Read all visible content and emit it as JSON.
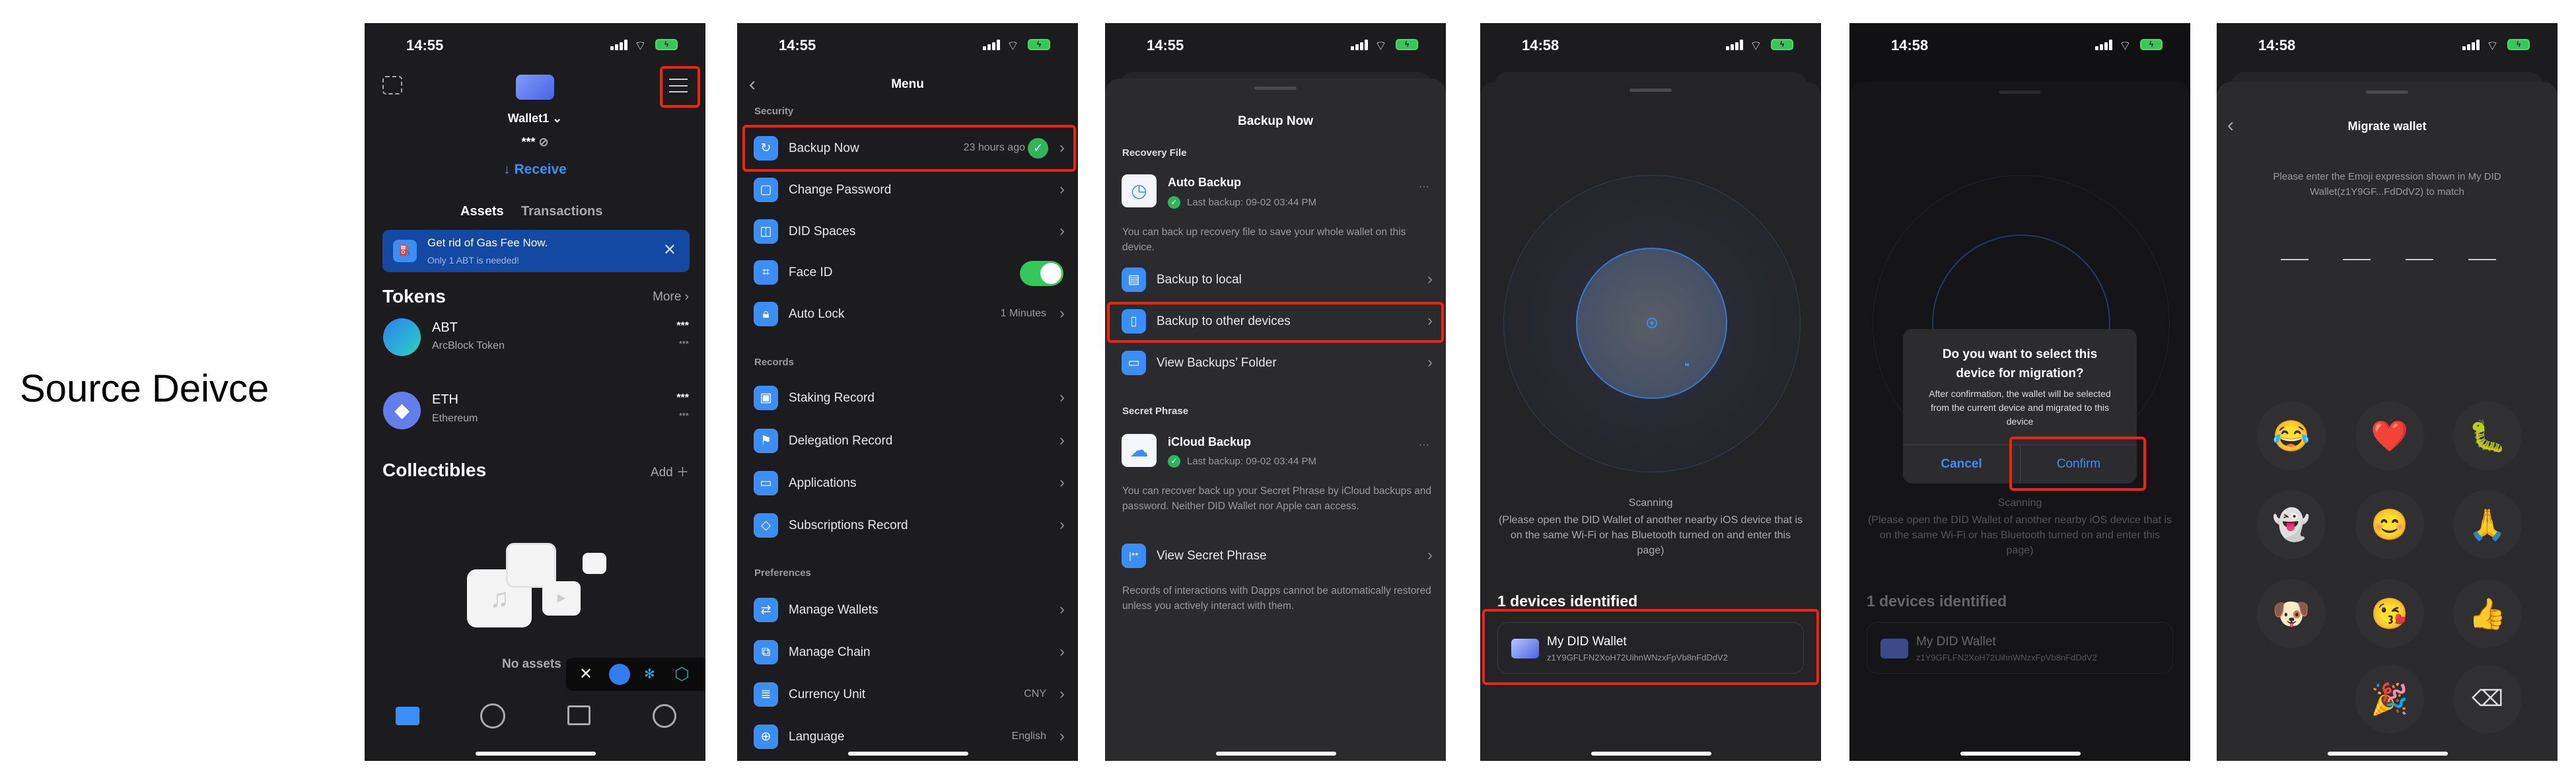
{
  "side_label": "Source Deivce",
  "accent_color": "#3a8ef6",
  "highlight_color": "#f0230f",
  "home": {
    "time": "14:55",
    "wallet_name": "Wallet1",
    "balance_masked": "***",
    "receive_label": "Receive",
    "tabs": [
      "Assets",
      "Transactions"
    ],
    "banner": {
      "title": "Get rid of Gas Fee Now.",
      "subtitle": "Only 1 ABT is needed!"
    },
    "tokens_heading": "Tokens",
    "more_label": "More",
    "tokens": [
      {
        "symbol": "ABT",
        "name": "ArcBlock Token",
        "amount": "***",
        "value": "***"
      },
      {
        "symbol": "ETH",
        "name": "Ethereum",
        "amount": "***",
        "value": "***"
      }
    ],
    "collectibles_heading": "Collectibles",
    "add_label": "Add",
    "empty_label": "No assets"
  },
  "menu": {
    "time": "14:55",
    "title": "Menu",
    "sections": [
      {
        "title": "Security",
        "items": [
          {
            "label": "Backup Now",
            "value": "23 hours ago",
            "icon": "refresh-icon"
          },
          {
            "label": "Change Password",
            "value": "",
            "icon": "lock-icon"
          },
          {
            "label": "DID Spaces",
            "value": "",
            "icon": "spaces-icon"
          },
          {
            "label": "Face ID",
            "value": "",
            "icon": "face-id-icon",
            "toggle": true
          },
          {
            "label": "Auto Lock",
            "value": "1 Minutes",
            "icon": "padlock-icon"
          }
        ]
      },
      {
        "title": "Records",
        "items": [
          {
            "label": "Staking Record",
            "value": "",
            "icon": "safe-icon"
          },
          {
            "label": "Delegation Record",
            "value": "",
            "icon": "flag-icon"
          },
          {
            "label": "Applications",
            "value": "",
            "icon": "window-icon"
          },
          {
            "label": "Subscriptions Record",
            "value": "",
            "icon": "diamond-icon"
          }
        ]
      },
      {
        "title": "Preferences",
        "items": [
          {
            "label": "Manage Wallets",
            "value": "",
            "icon": "swap-icon"
          },
          {
            "label": "Manage Chain",
            "value": "",
            "icon": "chain-icon"
          },
          {
            "label": "Currency Unit",
            "value": "CNY",
            "icon": "coins-icon"
          },
          {
            "label": "Language",
            "value": "English",
            "icon": "globe-icon"
          }
        ]
      }
    ]
  },
  "backup": {
    "time": "14:55",
    "title": "Backup Now",
    "recovery_heading": "Recovery File",
    "auto_backup": {
      "title": "Auto Backup",
      "status": "Last backup: 09-02 03:44 PM"
    },
    "recovery_desc": "You can back up recovery file to save your whole wallet on this device.",
    "recovery_items": [
      "Backup to local",
      "Backup to other devices",
      "View Backups’ Folder"
    ],
    "secret_heading": "Secret Phrase",
    "icloud_backup": {
      "title": "iCloud Backup",
      "status": "Last backup: 09-02 03:44 PM"
    },
    "secret_desc": "You can recover back up your Secret Phrase by iCloud backups and password. Neither DID Wallet nor Apple can access.",
    "view_secret": "View Secret Phrase",
    "records_note": "Records of interactions with Dapps cannot be automatically restored unless you actively interact with them."
  },
  "scan": {
    "time": "14:58",
    "status_title": "Scanning",
    "status_hint": "(Please open the DID Wallet of another nearby iOS device that is on the same Wi-Fi or has Bluetooth turned on and enter this page)",
    "devices_heading": "1 devices identified",
    "device": {
      "name": "My DID Wallet",
      "address": "z1Y9GFLFN2XoH72UihnWNzxFpVb8nFdDdV2"
    }
  },
  "confirm": {
    "time": "14:58",
    "dialog_title": "Do you want to select this device for migration?",
    "dialog_body": "After confirmation, the wallet will be selected from the current device and migrated to this device",
    "cancel": "Cancel",
    "confirm": "Confirm"
  },
  "migrate": {
    "time": "14:58",
    "title": "Migrate wallet",
    "instruction": "Please enter the Emoji expression shown in My DID Wallet(z1Y9GF...FdDdV2) to match",
    "slots_filled": 0,
    "slots_total": 4,
    "emojis": [
      "😂",
      "❤️",
      "🐛",
      "👻",
      "😊",
      "🙏",
      "🐶",
      "😘",
      "👍",
      "",
      "🎉",
      "⌫"
    ]
  }
}
